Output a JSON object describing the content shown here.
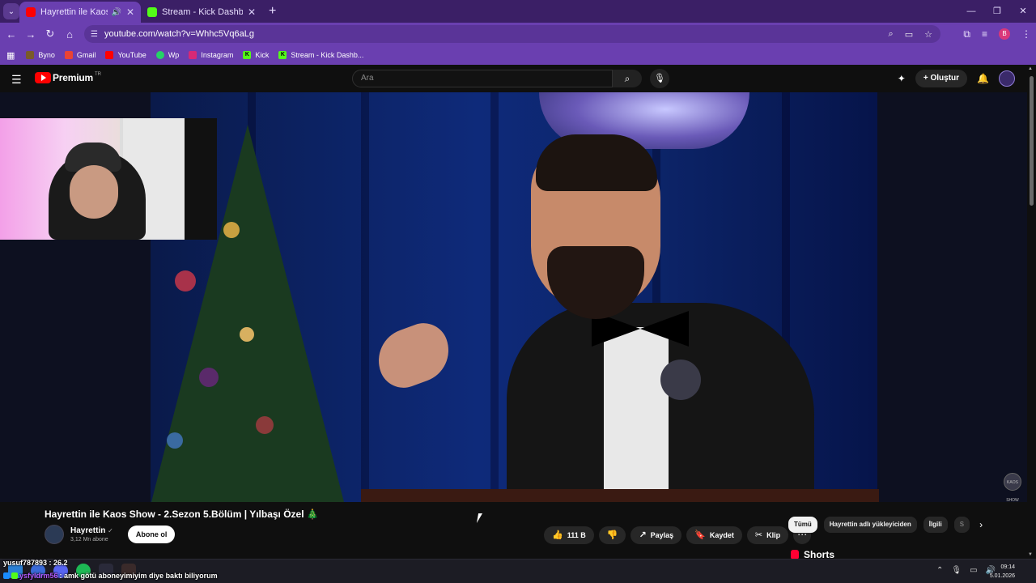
{
  "browser": {
    "tabs": [
      {
        "title": "Hayrettin ile Kaos Show - 2.",
        "active": true
      },
      {
        "title": "Stream - Kick Dashboard",
        "active": false
      }
    ],
    "url": "youtube.com/watch?v=Whhc5Vq6aLg",
    "bookmarks": [
      "Byno",
      "Gmail",
      "YouTube",
      "Wp",
      "Instagram",
      "Kick",
      "Stream - Kick Dashb..."
    ],
    "profile_letter": "B"
  },
  "youtube": {
    "logo_text": "Premium",
    "logo_cc": "TR",
    "search_placeholder": "Ara",
    "create_label": "Oluştur",
    "video_title": "Hayrettin ile Kaos Show - 2.Sezon 5.Bölüm | Yılbaşı Özel 🎄",
    "channel_name": "Hayrettin",
    "subscribers": "3,12 Mn abone",
    "subscribe_label": "Abone ol",
    "likes": "111 B",
    "share_label": "Paylaş",
    "save_label": "Kaydet",
    "clip_label": "Klip",
    "chips": [
      "Tümü",
      "Hayrettin adlı yükleyiciden",
      "İlgili",
      "S"
    ],
    "shorts_label": "Shorts",
    "floating_logo_text": "KAOS SHOW"
  },
  "stream_overlay": {
    "line1": "yusuf787893 : 26.2",
    "line2_user": "ysfyldrm56",
    "line2_msg": ": amk götü aboneyimiyim diye baktı biliyorum"
  },
  "taskbar": {
    "time": "09:14",
    "date": "5.01.2026"
  },
  "colors": {
    "tabbar": "#3b1f66",
    "toolbar": "#6a3fb0",
    "yt_red": "#ff0000",
    "yt_bg": "#0f0f0f"
  }
}
